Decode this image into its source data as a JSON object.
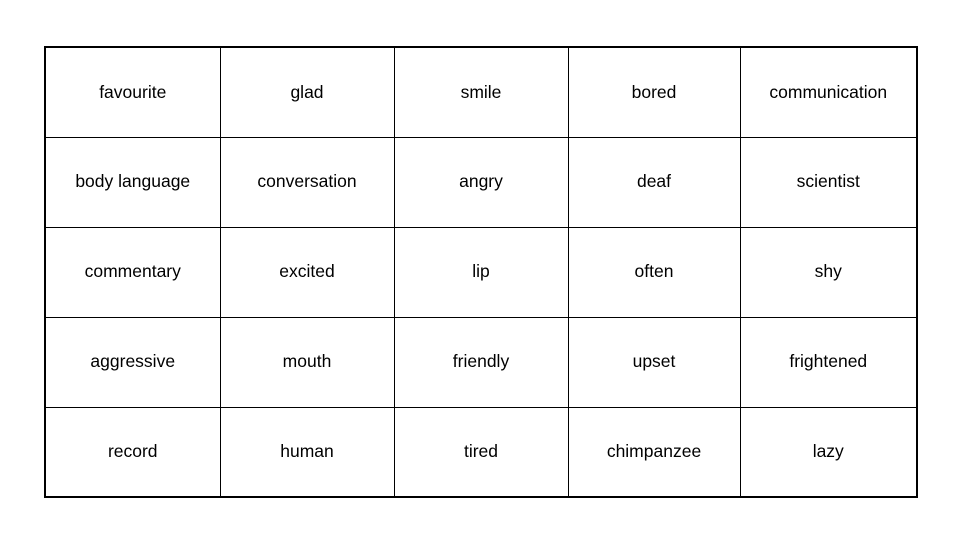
{
  "page": {
    "background_color": "#ffffff",
    "text_color": "#000000",
    "border_color": "#000000"
  },
  "table": {
    "columns": 5,
    "rows": 5,
    "cells": [
      [
        "favourite",
        "glad",
        "smile",
        "bored",
        "communication"
      ],
      [
        "body language",
        "conversation",
        "angry",
        "deaf",
        "scientist"
      ],
      [
        "commentary",
        "excited",
        "lip",
        "often",
        "shy"
      ],
      [
        "aggressive",
        "mouth",
        "friendly",
        "upset",
        "frightened"
      ],
      [
        "record",
        "human",
        "tired",
        "chimpanzee",
        "lazy"
      ]
    ]
  }
}
